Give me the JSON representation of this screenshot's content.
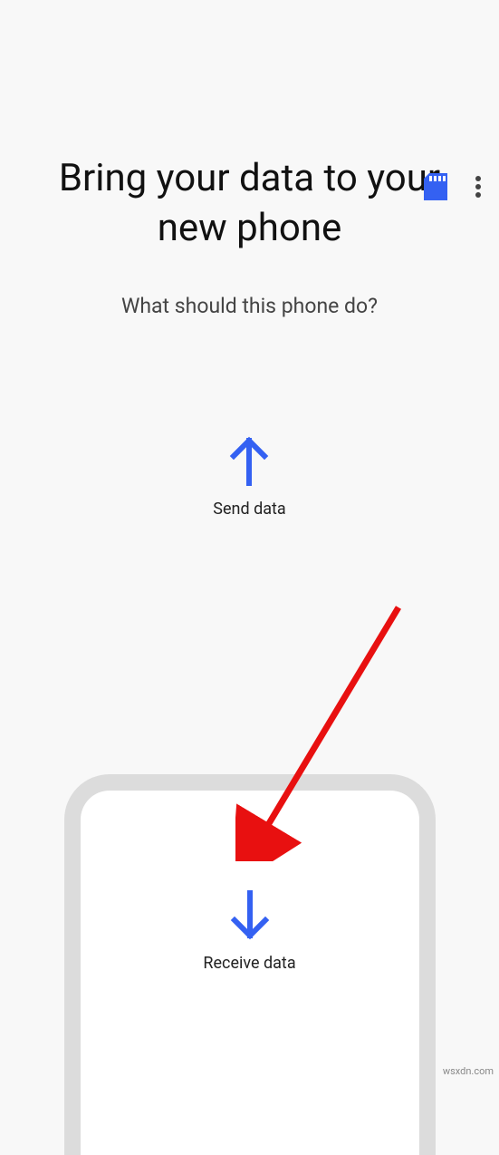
{
  "toolbar": {
    "sd_card_color": "#3461f2"
  },
  "header": {
    "title": "Bring your data to your new phone",
    "subtitle": "What should this phone do?"
  },
  "options": {
    "send_label": "Send data",
    "receive_label": "Receive data",
    "arrow_color": "#3461f2"
  },
  "watermark": "wsxdn.com"
}
